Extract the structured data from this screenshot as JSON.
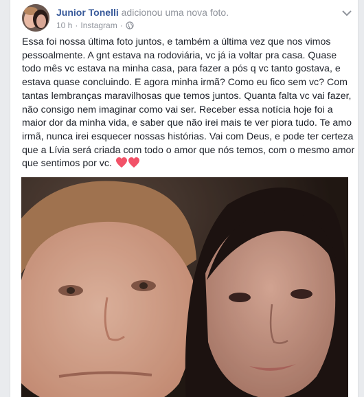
{
  "post": {
    "author": "Junior Tonelli",
    "action": "adicionou uma nova foto.",
    "time": "10 h",
    "source": "Instagram",
    "separator": "·",
    "text": "Essa foi nossa última foto juntos, e também a última vez que nos vimos pessoalmente. A gnt estava na rodoviária, vc já ia voltar pra casa. Quase todo mês vc estava na minha casa, para fazer a pós q vc tanto gostava, e estava quase concluindo. E agora minha irmã? Como eu fico sem vc? Com tantas lembranças maravilhosas que temos juntos. Quanta falta vc vai fazer, não consigo nem imaginar como vai ser. Receber essa notícia hoje foi a maior dor da minha vida, e saber que não irei mais te ver piora tudo. Te amo irmã, nunca irei esquecer nossas histórias. Vai com Deus, e pode ter certeza que a Lívia será criada com todo o amor que nós temos, com o mesmo amor que sentimos por vc.",
    "emoji_icon": "two-hearts-icon",
    "privacy_icon": "globe-icon",
    "menu_icon": "chevron-down-icon"
  },
  "colors": {
    "author_link": "#365899",
    "meta_text": "#90949c",
    "body_text": "#1d2129",
    "heart": "#f25268",
    "page_background": "#e9ebee"
  }
}
